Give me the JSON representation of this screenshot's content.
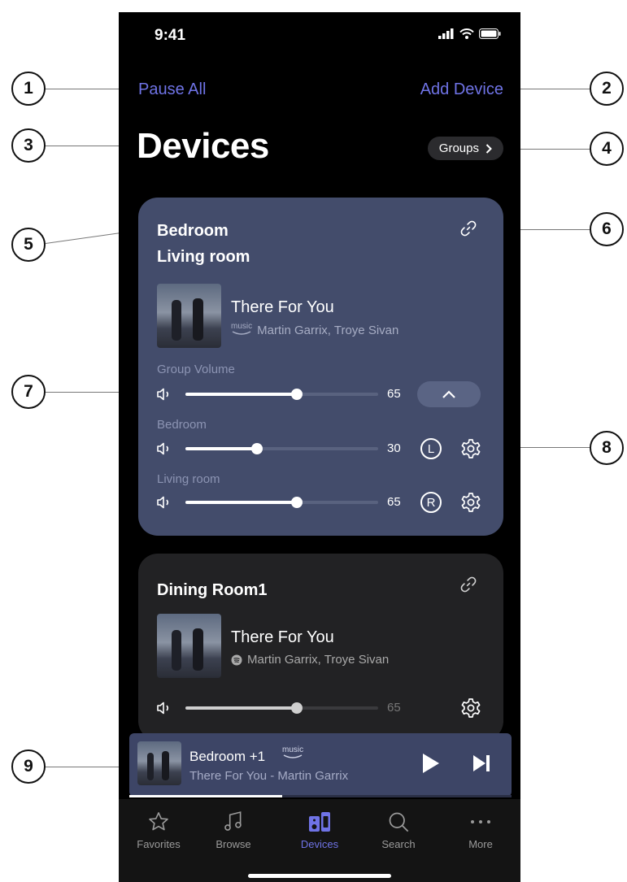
{
  "status_bar": {
    "time": "9:41"
  },
  "header": {
    "pause_all": "Pause All",
    "add_device": "Add Device",
    "title": "Devices",
    "groups_button": "Groups"
  },
  "group_card": {
    "rooms": [
      "Bedroom",
      "Living room"
    ],
    "track": {
      "title": "There For You",
      "artist": "Martin Garrix, Troye Sivan",
      "service": "music",
      "service_icon": "amazon-music-icon"
    },
    "group_volume": {
      "label": "Group Volume",
      "value": "65",
      "level": 0.58
    },
    "devices": [
      {
        "label": "Bedroom",
        "value": "30",
        "level": 0.37,
        "channel": "L"
      },
      {
        "label": "Living room",
        "value": "65",
        "level": 0.58,
        "channel": "R"
      }
    ]
  },
  "single_card": {
    "room": "Dining Room1",
    "track": {
      "title": "There For You",
      "artist": "Martin Garrix, Troye Sivan",
      "service_icon": "spotify-icon"
    },
    "volume": {
      "value": "65",
      "level": 0.58
    }
  },
  "mini_player": {
    "title": "Bedroom +1",
    "service": "music",
    "subtitle": "There For You - Martin Garrix",
    "progress": 0.4
  },
  "tabs": [
    {
      "label": "Favorites",
      "icon": "star-icon"
    },
    {
      "label": "Browse",
      "icon": "music-note-icon"
    },
    {
      "label": "Devices",
      "icon": "speakers-icon",
      "active": true
    },
    {
      "label": "Search",
      "icon": "search-icon"
    },
    {
      "label": "More",
      "icon": "more-icon"
    }
  ],
  "callouts": [
    "1",
    "2",
    "3",
    "4",
    "5",
    "6",
    "7",
    "8",
    "9"
  ],
  "colors": {
    "accent": "#6f73e6",
    "group_card": "#434c6b",
    "single_card": "#222224",
    "mini_player": "#3d4566"
  }
}
